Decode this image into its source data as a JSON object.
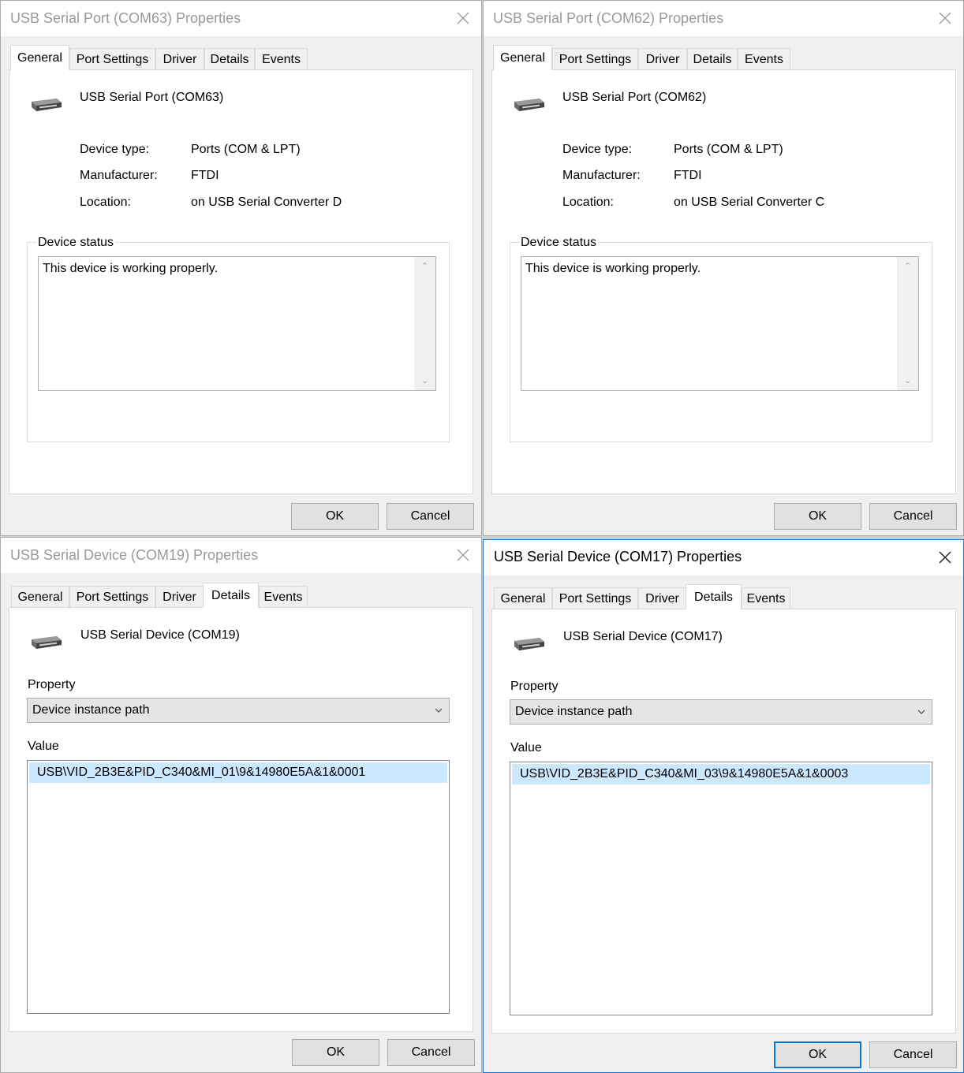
{
  "dialogs": [
    {
      "title": "USB Serial Port (COM63) Properties",
      "tabs": [
        "General",
        "Port Settings",
        "Driver",
        "Details",
        "Events"
      ],
      "selected_tab": "General",
      "device_name": "USB Serial Port (COM63)",
      "device_type_label": "Device type:",
      "device_type_value": "Ports (COM & LPT)",
      "manufacturer_label": "Manufacturer:",
      "manufacturer_value": "FTDI",
      "location_label": "Location:",
      "location_value": "on USB Serial Converter D",
      "status_group_label": "Device status",
      "status_text": "This device is working properly.",
      "ok_label": "OK",
      "cancel_label": "Cancel"
    },
    {
      "title": "USB Serial Port (COM62) Properties",
      "tabs": [
        "General",
        "Port Settings",
        "Driver",
        "Details",
        "Events"
      ],
      "selected_tab": "General",
      "device_name": "USB Serial Port (COM62)",
      "device_type_label": "Device type:",
      "device_type_value": "Ports (COM & LPT)",
      "manufacturer_label": "Manufacturer:",
      "manufacturer_value": "FTDI",
      "location_label": "Location:",
      "location_value": "on USB Serial Converter C",
      "status_group_label": "Device status",
      "status_text": "This device is working properly.",
      "ok_label": "OK",
      "cancel_label": "Cancel"
    },
    {
      "title": "USB Serial Device (COM19) Properties",
      "tabs": [
        "General",
        "Port Settings",
        "Driver",
        "Details",
        "Events"
      ],
      "selected_tab": "Details",
      "device_name": "USB Serial Device (COM19)",
      "property_label": "Property",
      "property_value": "Device instance path",
      "value_label": "Value",
      "value_text": "USB\\VID_2B3E&PID_C340&MI_01\\9&14980E5A&1&0001",
      "ok_label": "OK",
      "cancel_label": "Cancel"
    },
    {
      "title": "USB Serial Device (COM17) Properties",
      "tabs": [
        "General",
        "Port Settings",
        "Driver",
        "Details",
        "Events"
      ],
      "selected_tab": "Details",
      "device_name": "USB Serial Device (COM17)",
      "property_label": "Property",
      "property_value": "Device instance path",
      "value_label": "Value",
      "value_text": "USB\\VID_2B3E&PID_C340&MI_03\\9&14980E5A&1&0003",
      "ok_label": "OK",
      "cancel_label": "Cancel"
    }
  ],
  "icons": {
    "close": "close-icon",
    "device": "serial-port-icon",
    "dropdown": "chevron-down-icon",
    "scroll_up": "scroll-up-arrow-icon",
    "scroll_down": "scroll-down-arrow-icon"
  }
}
